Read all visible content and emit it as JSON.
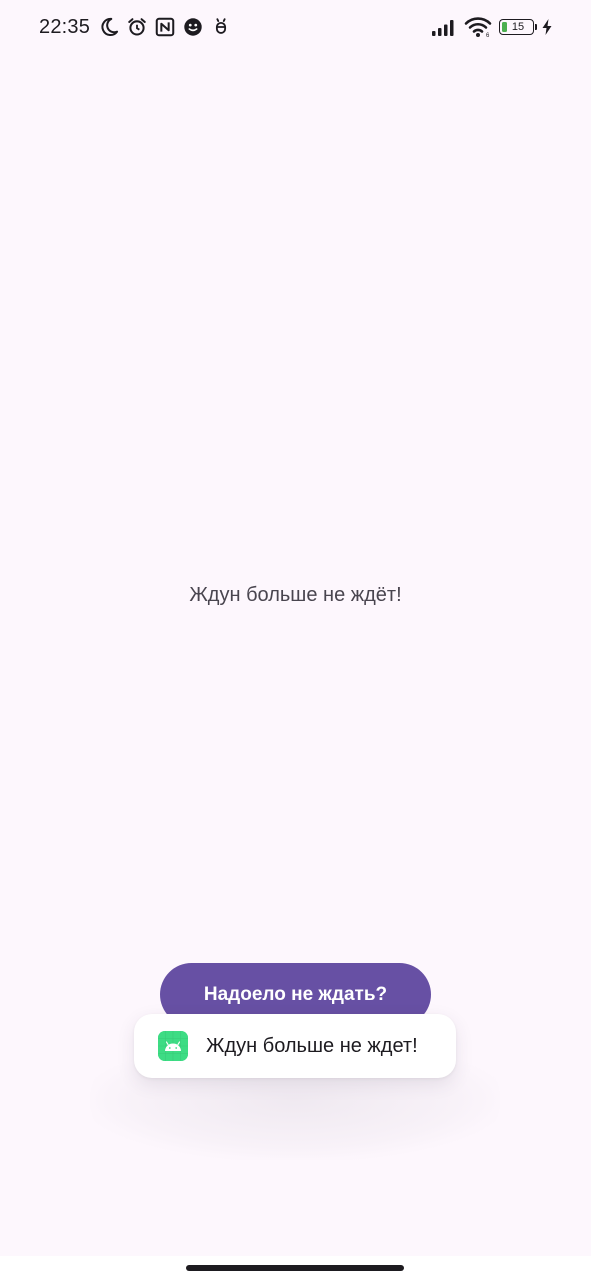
{
  "status_bar": {
    "time": "22:35",
    "left_icons": [
      "moon-icon",
      "alarm-icon",
      "nfc-icon",
      "messenger-icon",
      "debug-bug-icon"
    ],
    "right_icons": [
      "signal-icon",
      "wifi-icon",
      "battery-icon",
      "charging-bolt-icon"
    ],
    "battery_level": "15",
    "colors": {
      "foreground": "#1d1b20",
      "battery_fill": "#4caf50"
    }
  },
  "main": {
    "message": "Ждун больше не ждёт!",
    "button_label": "Надоело не ждать?"
  },
  "toast": {
    "app_icon": "android-app-icon",
    "text": "Ждун больше не ждет!"
  },
  "theme": {
    "background": "#fdf7fd",
    "primary": "#6750a4",
    "on_primary": "#ffffff",
    "text_secondary": "#49454f",
    "app_icon_color": "#3ddc84"
  }
}
